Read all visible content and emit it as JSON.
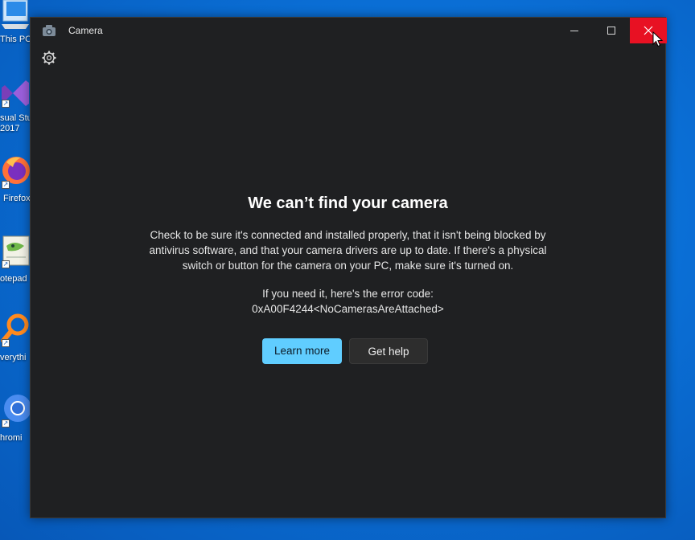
{
  "desktop": {
    "icons": [
      {
        "label": "This PC",
        "icon": "pc-icon"
      },
      {
        "label": "sual Stu\n2017",
        "icon": "visual-studio-icon"
      },
      {
        "label": "Firefox",
        "icon": "firefox-icon"
      },
      {
        "label": "otepad",
        "icon": "notepad-icon"
      },
      {
        "label": "verythi",
        "icon": "everything-search-icon"
      },
      {
        "label": "hromi",
        "icon": "chromium-icon"
      }
    ]
  },
  "window": {
    "title": "Camera",
    "heading": "We can’t find your camera",
    "body": "Check to be sure it's connected and installed properly, that it isn't being blocked by antivirus software, and that your camera drivers are up to date. If there's a physical switch or button for the camera on your PC, make sure it's turned on.",
    "error_label": "If you need it, here's the error code:",
    "error_code": "0xA00F4244<NoCamerasAreAttached>",
    "buttons": {
      "learn_more": "Learn more",
      "get_help": "Get help"
    }
  },
  "colors": {
    "desktop_bg": "#0a6fd6",
    "window_bg": "#1f2022",
    "accent": "#60cdff",
    "close_hover": "#e81123"
  }
}
